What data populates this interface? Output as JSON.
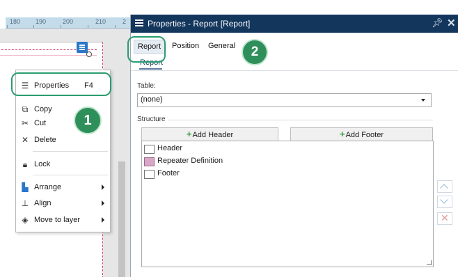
{
  "ruler": {
    "ticks": [
      "180",
      "190",
      "200",
      "210",
      "2"
    ]
  },
  "context_menu": {
    "items": [
      {
        "label": "Properties",
        "shortcut": "F4",
        "icon": "hamburger-icon"
      },
      {
        "label": "Copy",
        "icon": "copy-icon"
      },
      {
        "label": "Cut",
        "icon": "scissors-icon"
      },
      {
        "label": "Delete",
        "icon": "close-x-icon"
      },
      {
        "label": "Lock",
        "icon": "lock-icon"
      },
      {
        "label": "Arrange",
        "icon": "arrange-icon",
        "submenu": true
      },
      {
        "label": "Align",
        "icon": "align-icon",
        "submenu": true
      },
      {
        "label": "Move to layer",
        "icon": "layers-icon",
        "submenu": true
      }
    ]
  },
  "callouts": {
    "step1": "1",
    "step2": "2",
    "color": "#2f8f5a"
  },
  "panel": {
    "title": "Properties - Report [Report]",
    "tabs": [
      "Report",
      "Position",
      "General"
    ],
    "active_tab": "Report",
    "subtab": "Report",
    "table_label": "Table:",
    "table_value": "(none)",
    "structure_label": "Structure",
    "add_header_label": "Add Header",
    "add_footer_label": "Add Footer",
    "tree": [
      {
        "label": "Header"
      },
      {
        "label": "Repeater Definition"
      },
      {
        "label": "Footer"
      }
    ],
    "header_color": "#13365d"
  }
}
